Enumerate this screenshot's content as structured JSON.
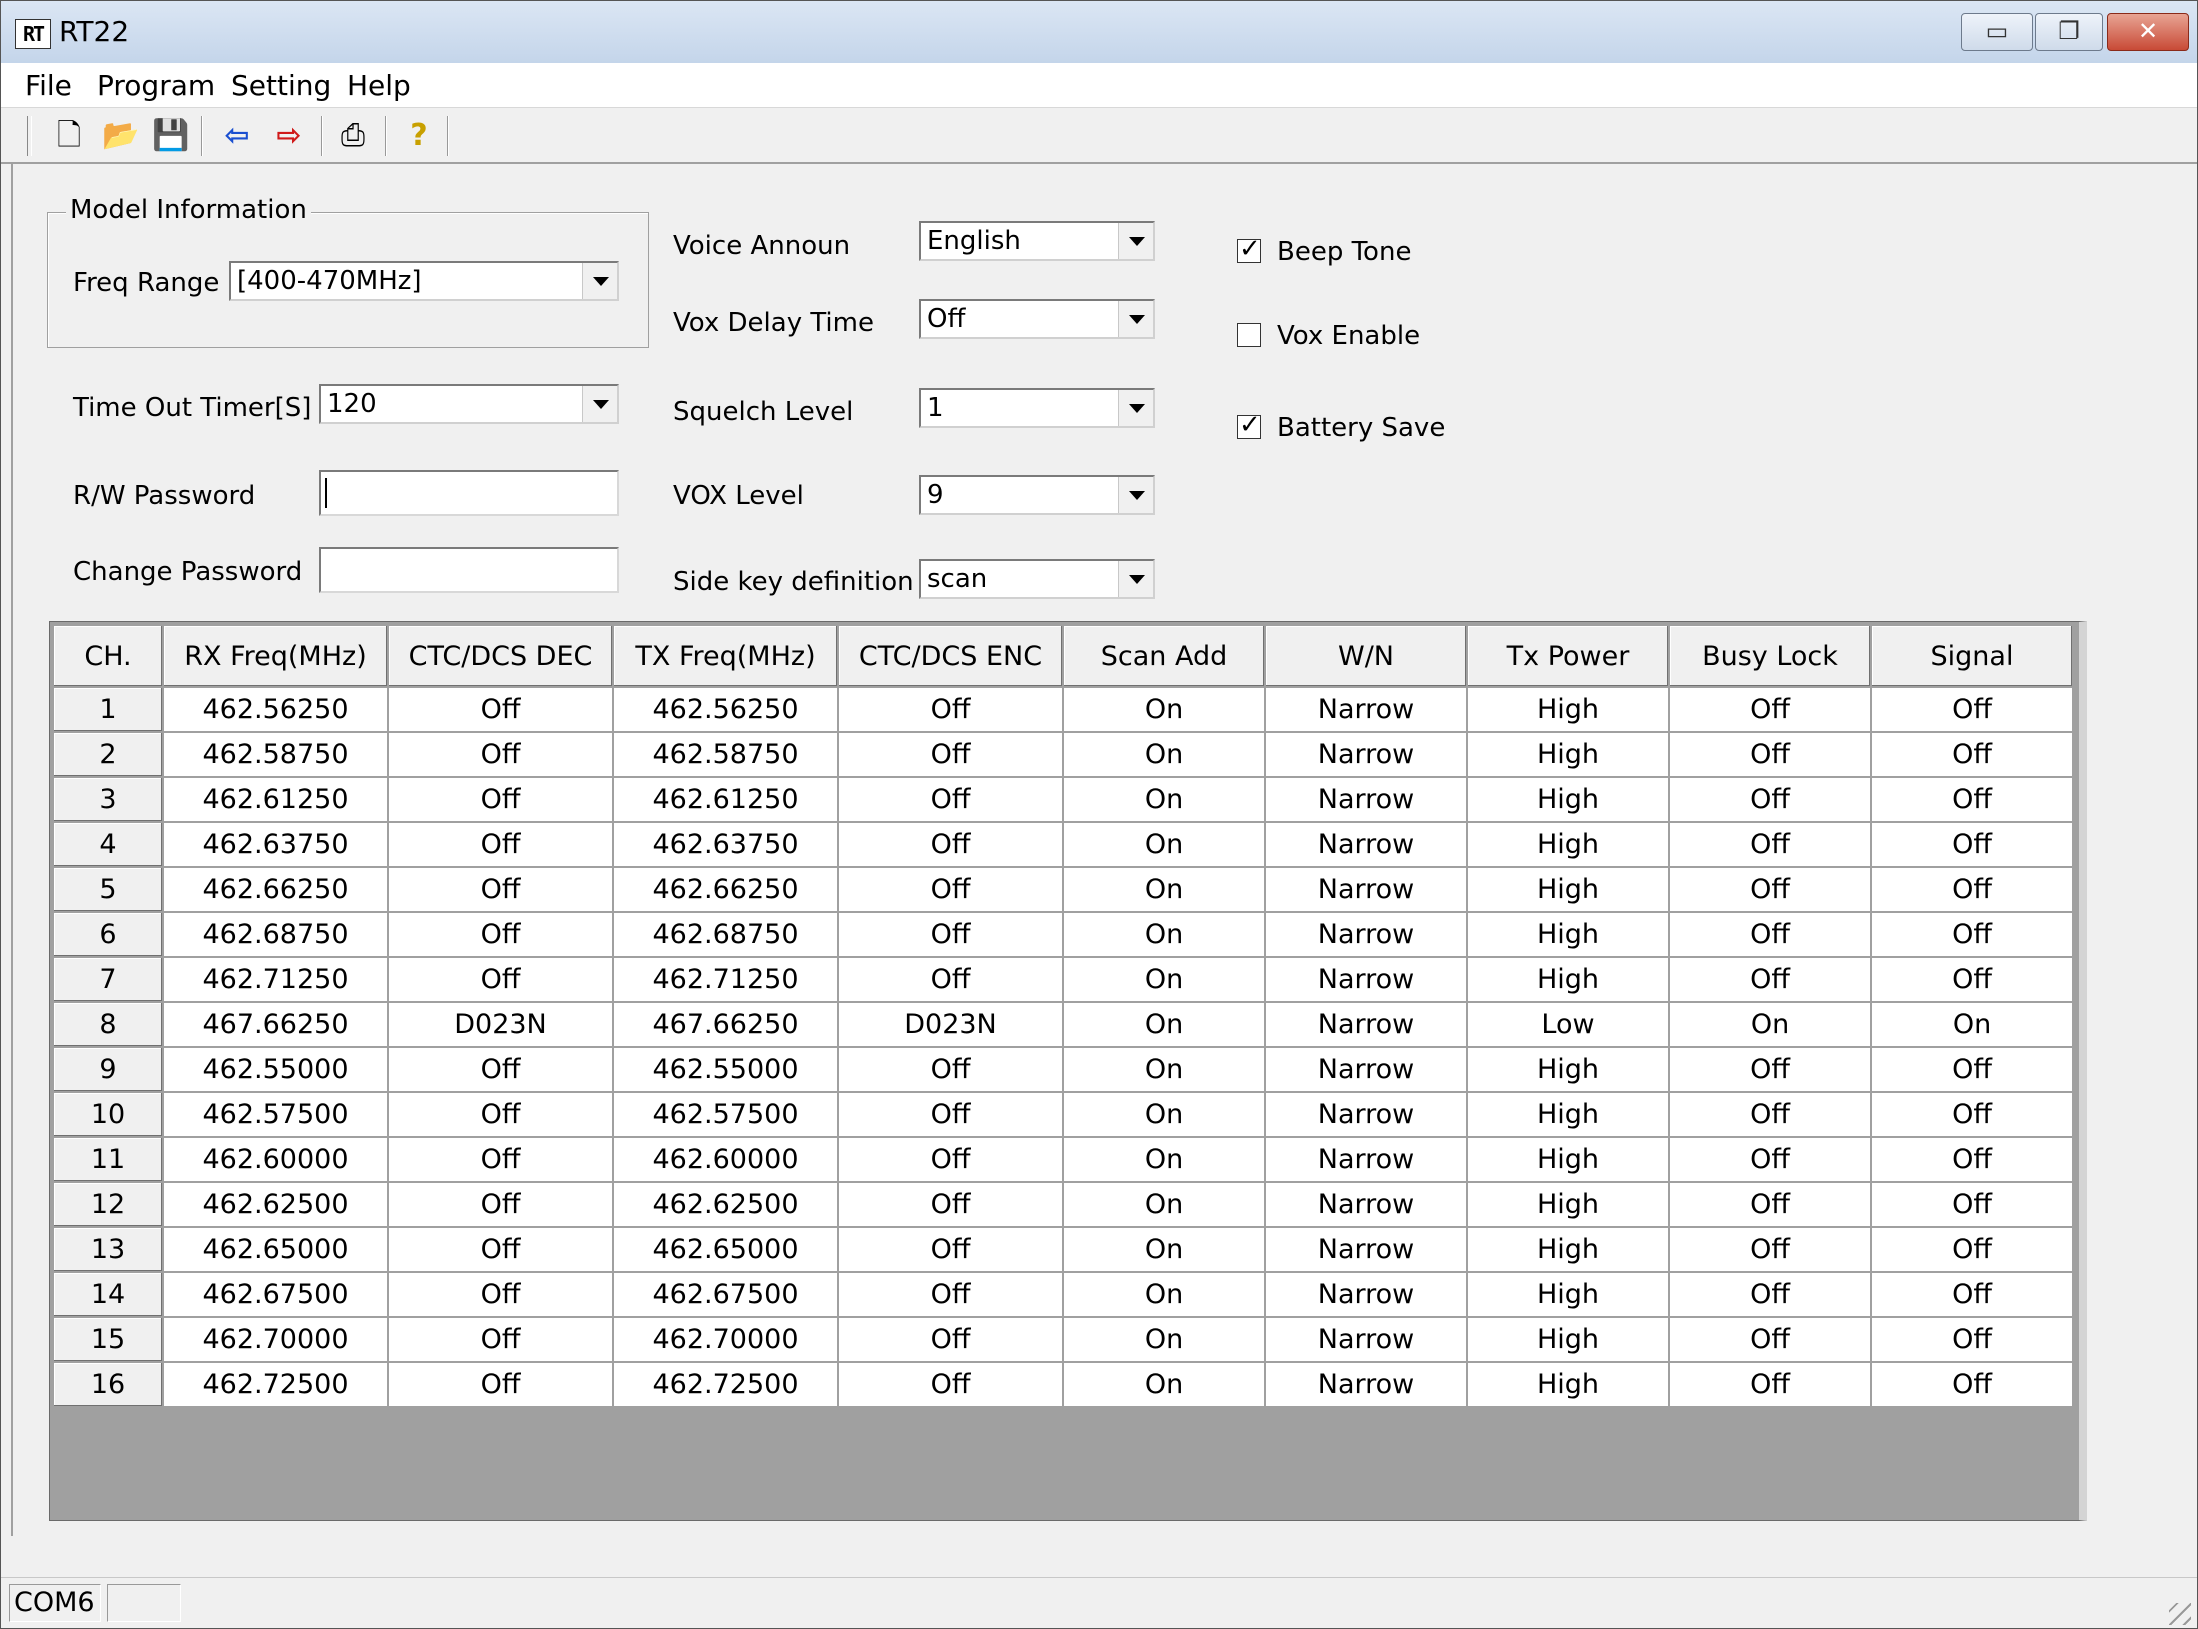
{
  "window": {
    "title": "RT22",
    "app_icon_text": "RT",
    "controls": {
      "minimize": "▭",
      "maximize": "❐",
      "close": "✕"
    }
  },
  "menu": [
    {
      "label": "File"
    },
    {
      "label": "Program"
    },
    {
      "label": "Setting"
    },
    {
      "label": "Help"
    }
  ],
  "toolbar": {
    "new": "🗋",
    "open": "📂",
    "save": "💾",
    "read": "⇦",
    "write": "⇨",
    "print": "⎙",
    "help": "?"
  },
  "model_info": {
    "legend": "Model Information",
    "freq_range_label": "Freq Range",
    "freq_range_value": "[400-470MHz]"
  },
  "settings": {
    "time_out_label": "Time Out Timer[S]",
    "time_out_value": "120",
    "rw_password_label": "R/W Password",
    "rw_password_value": "",
    "change_password_label": "Change Password",
    "change_password_value": "",
    "voice_label": "Voice Announ",
    "voice_value": "English",
    "vox_delay_label": "Vox Delay Time",
    "vox_delay_value": "Off",
    "squelch_label": "Squelch Level",
    "squelch_value": "1",
    "vox_level_label": "VOX Level",
    "vox_level_value": "9",
    "side_key_label": "Side key definition",
    "side_key_value": "scan",
    "beep_tone_label": "Beep Tone",
    "beep_tone_checked": true,
    "vox_enable_label": "Vox Enable",
    "vox_enable_checked": false,
    "battery_save_label": "Battery Save",
    "battery_save_checked": true
  },
  "table": {
    "columns": [
      "CH.",
      "RX Freq(MHz)",
      "CTC/DCS DEC",
      "TX Freq(MHz)",
      "CTC/DCS ENC",
      "Scan Add",
      "W/N",
      "Tx Power",
      "Busy Lock",
      "Signal"
    ],
    "rows": [
      [
        "1",
        "462.56250",
        "Off",
        "462.56250",
        "Off",
        "On",
        "Narrow",
        "High",
        "Off",
        "Off"
      ],
      [
        "2",
        "462.58750",
        "Off",
        "462.58750",
        "Off",
        "On",
        "Narrow",
        "High",
        "Off",
        "Off"
      ],
      [
        "3",
        "462.61250",
        "Off",
        "462.61250",
        "Off",
        "On",
        "Narrow",
        "High",
        "Off",
        "Off"
      ],
      [
        "4",
        "462.63750",
        "Off",
        "462.63750",
        "Off",
        "On",
        "Narrow",
        "High",
        "Off",
        "Off"
      ],
      [
        "5",
        "462.66250",
        "Off",
        "462.66250",
        "Off",
        "On",
        "Narrow",
        "High",
        "Off",
        "Off"
      ],
      [
        "6",
        "462.68750",
        "Off",
        "462.68750",
        "Off",
        "On",
        "Narrow",
        "High",
        "Off",
        "Off"
      ],
      [
        "7",
        "462.71250",
        "Off",
        "462.71250",
        "Off",
        "On",
        "Narrow",
        "High",
        "Off",
        "Off"
      ],
      [
        "8",
        "467.66250",
        "D023N",
        "467.66250",
        "D023N",
        "On",
        "Narrow",
        "Low",
        "On",
        "On"
      ],
      [
        "9",
        "462.55000",
        "Off",
        "462.55000",
        "Off",
        "On",
        "Narrow",
        "High",
        "Off",
        "Off"
      ],
      [
        "10",
        "462.57500",
        "Off",
        "462.57500",
        "Off",
        "On",
        "Narrow",
        "High",
        "Off",
        "Off"
      ],
      [
        "11",
        "462.60000",
        "Off",
        "462.60000",
        "Off",
        "On",
        "Narrow",
        "High",
        "Off",
        "Off"
      ],
      [
        "12",
        "462.62500",
        "Off",
        "462.62500",
        "Off",
        "On",
        "Narrow",
        "High",
        "Off",
        "Off"
      ],
      [
        "13",
        "462.65000",
        "Off",
        "462.65000",
        "Off",
        "On",
        "Narrow",
        "High",
        "Off",
        "Off"
      ],
      [
        "14",
        "462.67500",
        "Off",
        "462.67500",
        "Off",
        "On",
        "Narrow",
        "High",
        "Off",
        "Off"
      ],
      [
        "15",
        "462.70000",
        "Off",
        "462.70000",
        "Off",
        "On",
        "Narrow",
        "High",
        "Off",
        "Off"
      ],
      [
        "16",
        "462.72500",
        "Off",
        "462.72500",
        "Off",
        "On",
        "Narrow",
        "High",
        "Off",
        "Off"
      ]
    ]
  },
  "status": {
    "port": "COM6",
    "pane2": ""
  }
}
